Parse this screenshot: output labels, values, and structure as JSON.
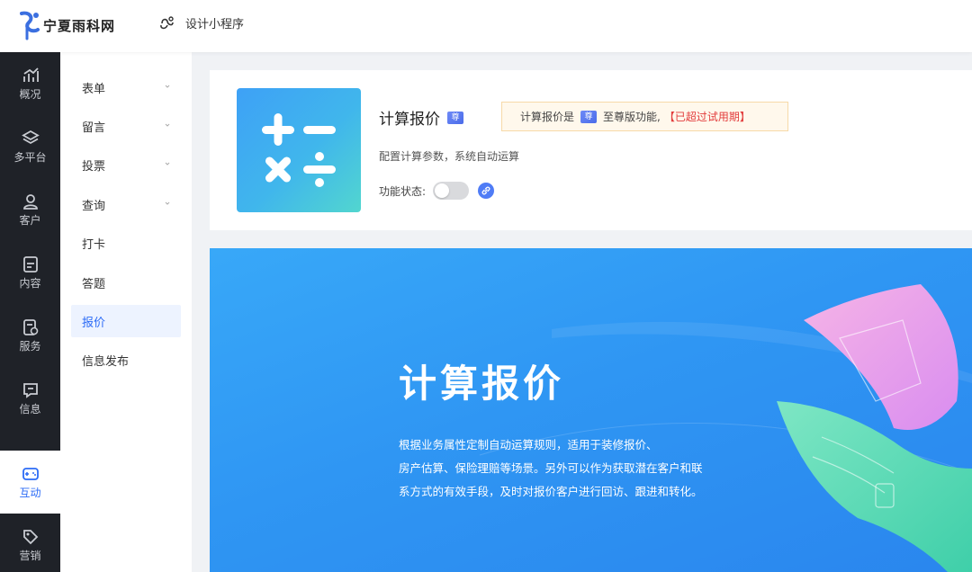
{
  "header": {
    "logo_text": "宁夏雨科网",
    "mini_program_link": "设计小程序"
  },
  "rail": {
    "items": [
      {
        "label": "概况",
        "icon": "chart-icon"
      },
      {
        "label": "多平台",
        "icon": "layers-icon"
      },
      {
        "label": "客户",
        "icon": "user-icon"
      },
      {
        "label": "内容",
        "icon": "document-icon"
      },
      {
        "label": "服务",
        "icon": "service-icon"
      },
      {
        "label": "信息",
        "icon": "message-icon"
      },
      {
        "label": "互动",
        "icon": "gamepad-icon",
        "active": true
      },
      {
        "label": "营销",
        "icon": "tag-icon"
      }
    ]
  },
  "submenu": {
    "items": [
      {
        "label": "表单",
        "has_caret": true
      },
      {
        "label": "留言",
        "has_caret": true
      },
      {
        "label": "投票",
        "has_caret": true
      },
      {
        "label": "查询",
        "has_caret": true
      },
      {
        "label": "打卡",
        "has_caret": false
      },
      {
        "label": "答题",
        "has_caret": false
      },
      {
        "label": "报价",
        "has_caret": false,
        "active": true
      },
      {
        "label": "信息发布",
        "has_caret": false
      }
    ]
  },
  "feature": {
    "title": "计算报价",
    "vip_badge": "尊",
    "notice_prefix": "计算报价是",
    "notice_suffix": "至尊版功能,",
    "notice_warning": "【已超过试用期】",
    "description": "配置计算参数，系统自动运算",
    "status_label": "功能状态:",
    "status_enabled": false
  },
  "banner": {
    "title": "计算报价",
    "description_lines": [
      "根据业务属性定制自动运算规则，适用于装修报价、",
      "房产估算、保险理赔等场景。另外可以作为获取潜在客户和联",
      "系方式的有效手段，及时对报价客户进行回访、跟进和转化。"
    ]
  },
  "colors": {
    "accent": "#2d6cf6",
    "rail_bg": "#1f2228",
    "warning": "#e23b3b"
  }
}
